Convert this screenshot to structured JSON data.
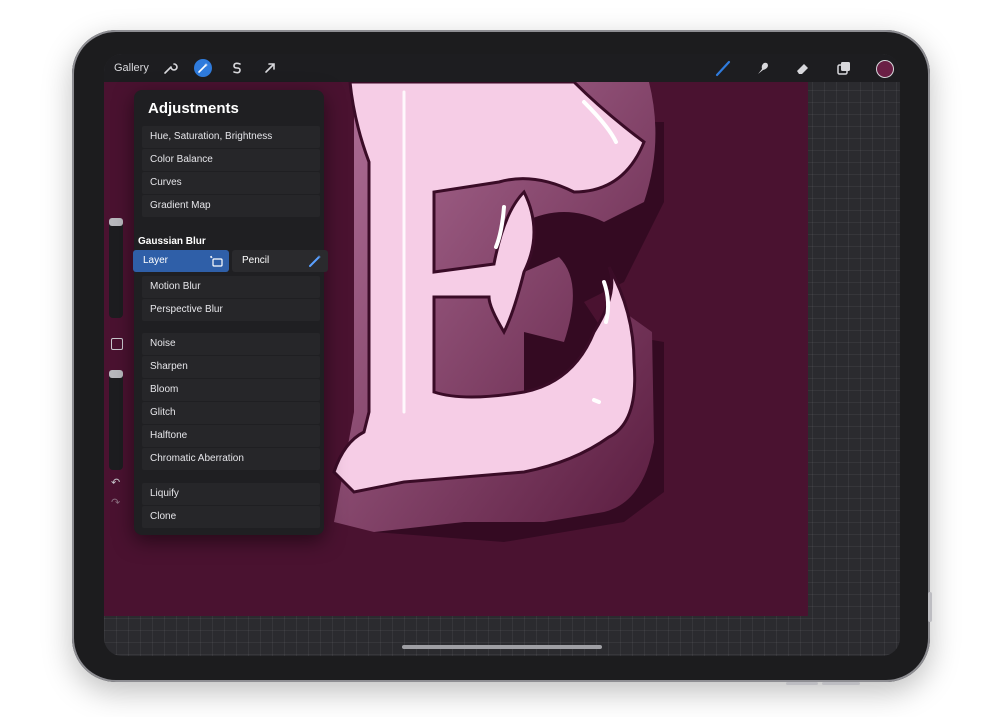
{
  "colors": {
    "canvas_bg": "#4a1230",
    "accent": "#2f7bdc",
    "letter_fill": "#f6cde6"
  },
  "toolbar": {
    "gallery_label": "Gallery",
    "left_icons": [
      "wrench-icon",
      "magic-wand-icon",
      "selection-s-icon",
      "arrow-icon"
    ],
    "right_icons": [
      "brush-icon",
      "smudge-icon",
      "eraser-icon",
      "layers-icon",
      "color-swatch-icon"
    ]
  },
  "adjustments": {
    "title": "Adjustments",
    "group1": [
      "Hue, Saturation, Brightness",
      "Color Balance",
      "Curves",
      "Gradient Map"
    ],
    "gaussian": {
      "title": "Gaussian Blur",
      "layer_label": "Layer",
      "pencil_label": "Pencil"
    },
    "group2": [
      "Motion Blur",
      "Perspective Blur"
    ],
    "group3": [
      "Noise",
      "Sharpen",
      "Bloom",
      "Glitch",
      "Halftone",
      "Chromatic Aberration"
    ],
    "group4": [
      "Liquify",
      "Clone"
    ]
  }
}
